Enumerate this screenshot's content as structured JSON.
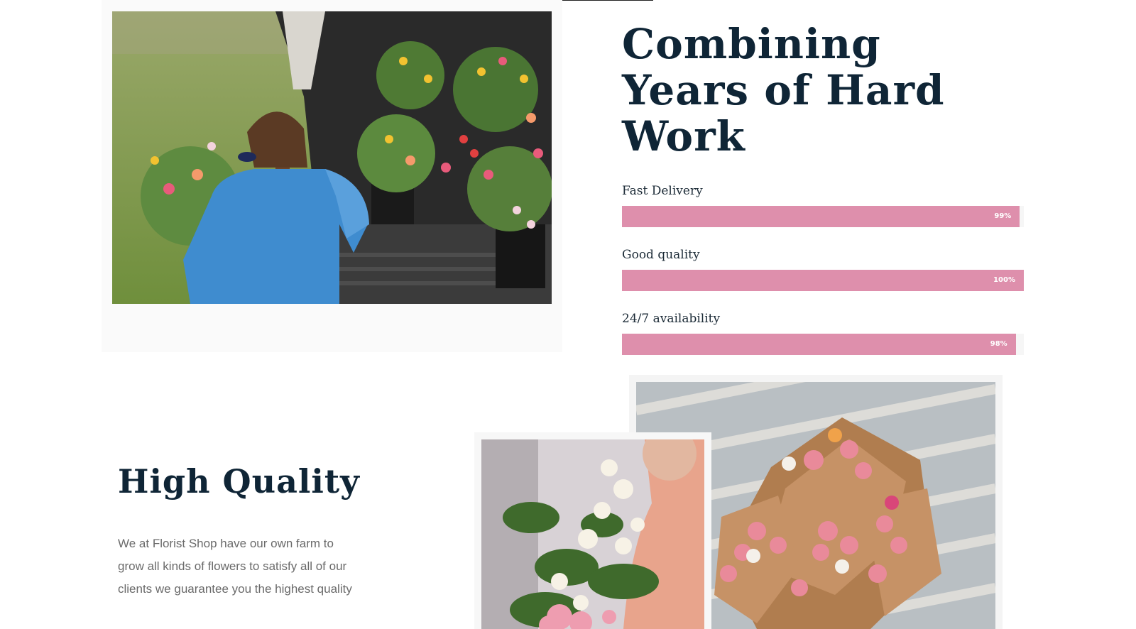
{
  "section_skills": {
    "heading": "Combining Years of Hard Work",
    "skills": [
      {
        "label": "Fast Delivery",
        "value_text": "99%",
        "value": 99
      },
      {
        "label": "Good quality",
        "value_text": "100%",
        "value": 100
      },
      {
        "label": "24/7 availability",
        "value_text": "98%",
        "value": 98
      }
    ]
  },
  "section_quality": {
    "heading": "High Quality",
    "body": "We at Florist Shop have our own farm to grow all kinds of flowers to satisfy all of our clients we guarantee you the highest quality"
  },
  "images": {
    "farm_photo": "girl-loading-flowers-into-truck",
    "holding_photo": "woman-holding-flower-arrangement",
    "bouquet_photo": "paper-wrapped-ranunculus-bouquets"
  },
  "colors": {
    "bar_fill": "#de8fac",
    "heading": "#0f2536",
    "body_text": "#6a6a6a",
    "nav_accent": "#1b6fb0"
  }
}
